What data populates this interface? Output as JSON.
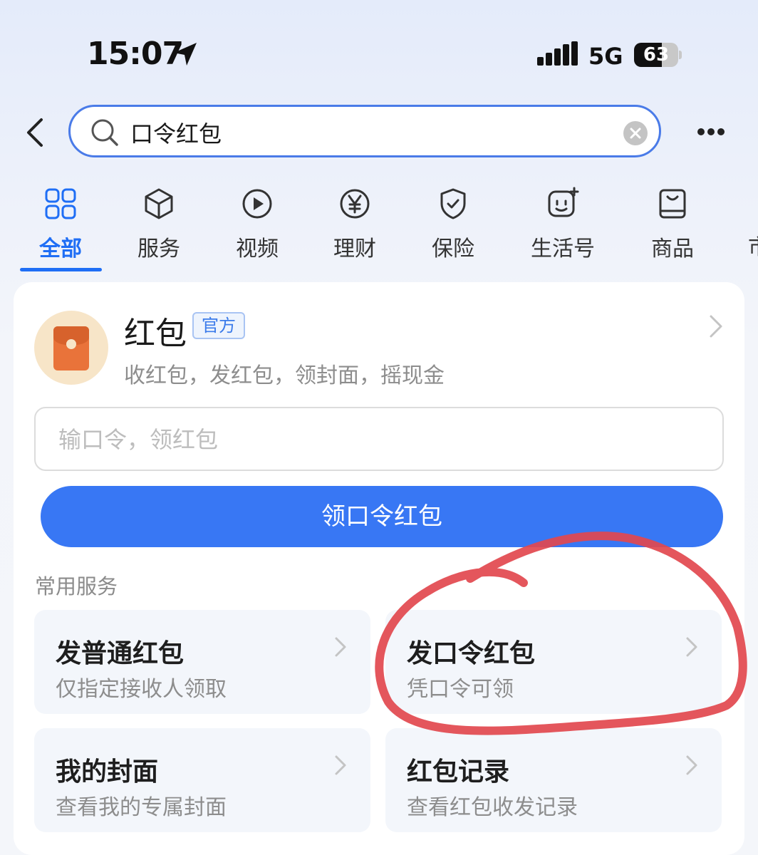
{
  "status_bar": {
    "time": "15:07",
    "network": "5G",
    "battery": "63"
  },
  "search": {
    "query": "口令红包",
    "icons": {
      "back": "chevron-left-icon",
      "search": "search-icon",
      "clear": "clear-icon",
      "more": "more-dots-icon"
    }
  },
  "tabs": [
    {
      "label": "全部",
      "icon": "grid-icon",
      "active": true
    },
    {
      "label": "服务",
      "icon": "cube-icon"
    },
    {
      "label": "视频",
      "icon": "play-icon"
    },
    {
      "label": "理财",
      "icon": "yen-icon"
    },
    {
      "label": "保险",
      "icon": "shield-check-icon"
    },
    {
      "label": "生活号",
      "icon": "life-account-icon"
    },
    {
      "label": "商品",
      "icon": "shopping-bag-icon"
    },
    {
      "label": "市"
    }
  ],
  "service": {
    "name": "红包",
    "badge": "官方",
    "description": "收红包，发红包，领封面，摇现金",
    "input_placeholder": "输口令，领红包",
    "claim_button": "领口令红包"
  },
  "common_services": {
    "title": "常用服务",
    "items": [
      {
        "title": "发普通红包",
        "subtitle": "仅指定接收人领取"
      },
      {
        "title": "发口令红包",
        "subtitle": "凭口令可领"
      },
      {
        "title": "我的封面",
        "subtitle": "查看我的专属封面"
      },
      {
        "title": "红包记录",
        "subtitle": "查看红包收发记录"
      }
    ]
  },
  "colors": {
    "accent": "#1f6ef5",
    "button": "#3877f4",
    "annotation": "#e2484e",
    "envelope": "#e9733a"
  }
}
